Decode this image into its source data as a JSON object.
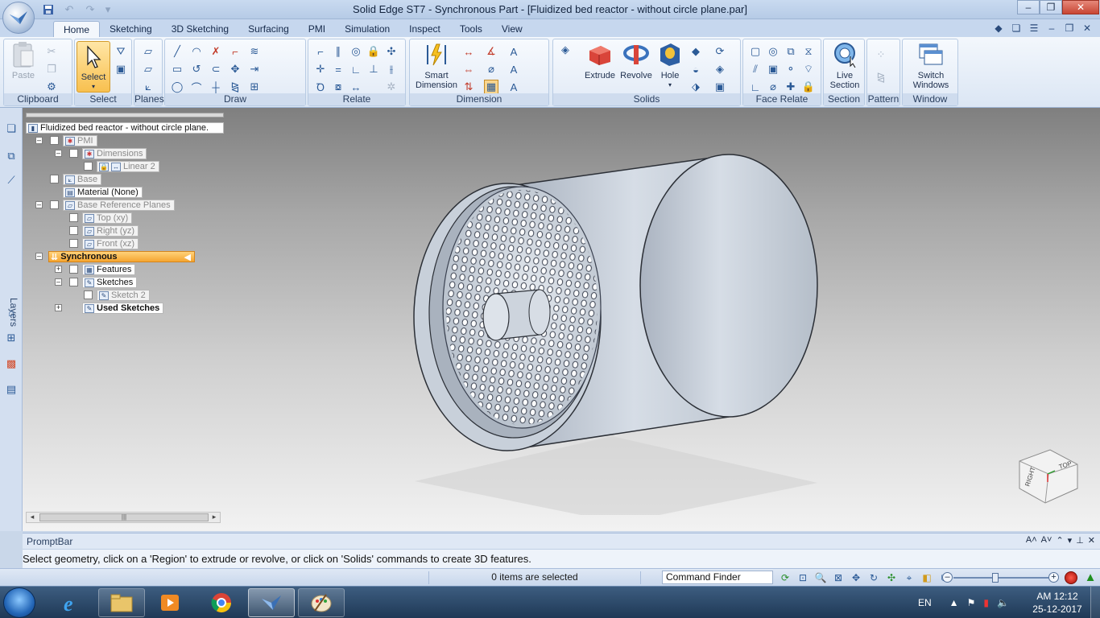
{
  "window": {
    "title": "Solid Edge ST7 - Synchronous Part - [Fluidized bed reactor - without circle plane.par]"
  },
  "quick_access": [
    "save-icon",
    "undo-icon",
    "redo-icon",
    "customize-icon"
  ],
  "tabs": [
    {
      "label": "Home",
      "active": true
    },
    {
      "label": "Sketching"
    },
    {
      "label": "3D Sketching"
    },
    {
      "label": "Surfacing"
    },
    {
      "label": "PMI"
    },
    {
      "label": "Simulation"
    },
    {
      "label": "Inspect"
    },
    {
      "label": "Tools"
    },
    {
      "label": "View"
    }
  ],
  "ribbon": {
    "groups": {
      "clipboard": "Clipboard",
      "select": "Select",
      "planes": "Planes",
      "draw": "Draw",
      "relate": "Relate",
      "dimension": "Dimension",
      "solids": "Solids",
      "face_relate": "Face Relate",
      "section": "Section",
      "pattern": "Pattern",
      "window": "Window"
    },
    "buttons": {
      "paste": "Paste",
      "select": "Select",
      "smart_dimension_1": "Smart",
      "smart_dimension_2": "Dimension",
      "extrude": "Extrude",
      "revolve": "Revolve",
      "hole": "Hole",
      "live_section_1": "Live",
      "live_section_2": "Section",
      "switch_windows_1": "Switch",
      "switch_windows_2": "Windows"
    }
  },
  "pathfinder": {
    "root": "Fluidized bed reactor - without circle plane.",
    "pmi": "PMI",
    "dimensions": "Dimensions",
    "linear": "Linear 2",
    "base": "Base",
    "material": "Material (None)",
    "base_ref_planes": "Base Reference Planes",
    "top": "Top (xy)",
    "right": "Right (yz)",
    "front": "Front (xz)",
    "synchronous": "Synchronous",
    "features": "Features",
    "sketches": "Sketches",
    "sketch2": "Sketch 2",
    "used_sketches": "Used Sketches"
  },
  "left_strip": {
    "layers": "Layers"
  },
  "viewcube": {
    "top": "TOP",
    "right": "RIGHT"
  },
  "promptbar": {
    "title": "PromptBar",
    "message": "Select geometry, click on a 'Region' to extrude or revolve, or click on 'Solids' commands to create 3D features."
  },
  "status": {
    "selection": "0 items are selected",
    "command_finder": "Command Finder"
  },
  "taskbar": {
    "language": "EN",
    "time": "AM 12:12",
    "date": "25-12-2017"
  },
  "colors": {
    "model_body": "#cfd6df",
    "sync_highlight": "#f5a530",
    "ribbon_bg": "#e8eff8"
  }
}
